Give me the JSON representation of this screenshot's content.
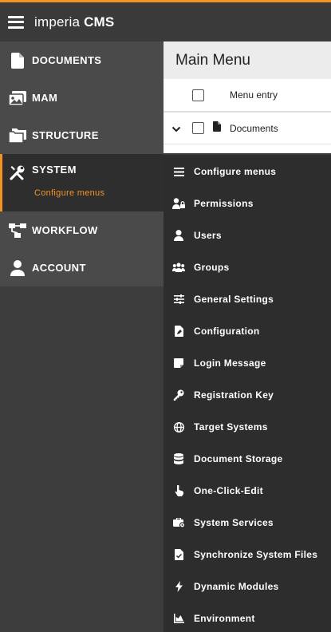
{
  "brand": {
    "name_light": "imperia",
    "name_bold": "CMS",
    "accent": "#f39325"
  },
  "nav": [
    {
      "label": "DOCUMENTS",
      "icon": "document-icon"
    },
    {
      "label": "MAM",
      "icon": "images-icon"
    },
    {
      "label": "STRUCTURE",
      "icon": "folders-icon"
    },
    {
      "label": "SYSTEM",
      "icon": "tools-icon",
      "active": true,
      "sub_label": "Configure menus"
    },
    {
      "label": "WORKFLOW",
      "icon": "workflow-icon"
    },
    {
      "label": "ACCOUNT",
      "icon": "user-icon"
    }
  ],
  "main": {
    "title": "Main Menu",
    "column_header": "Menu entry",
    "rows": [
      {
        "label": "Documents",
        "expanded": true
      }
    ]
  },
  "submenu": [
    {
      "label": "Configure menus",
      "icon": "list-icon"
    },
    {
      "label": "Permissions",
      "icon": "user-lock-icon"
    },
    {
      "label": "Users",
      "icon": "user-icon"
    },
    {
      "label": "Groups",
      "icon": "group-icon"
    },
    {
      "label": "General Settings",
      "icon": "sliders-icon"
    },
    {
      "label": "Configuration",
      "icon": "file-edit-icon"
    },
    {
      "label": "Login Message",
      "icon": "note-icon"
    },
    {
      "label": "Registration Key",
      "icon": "key-icon"
    },
    {
      "label": "Target Systems",
      "icon": "globe-icon"
    },
    {
      "label": "Document Storage",
      "icon": "database-icon"
    },
    {
      "label": "One-Click-Edit",
      "icon": "pointer-icon"
    },
    {
      "label": "System Services",
      "icon": "toolbox-icon"
    },
    {
      "label": "Synchronize System Files",
      "icon": "file-check-icon"
    },
    {
      "label": "Dynamic Modules",
      "icon": "bolt-icon"
    },
    {
      "label": "Environment",
      "icon": "chart-area-icon"
    }
  ]
}
